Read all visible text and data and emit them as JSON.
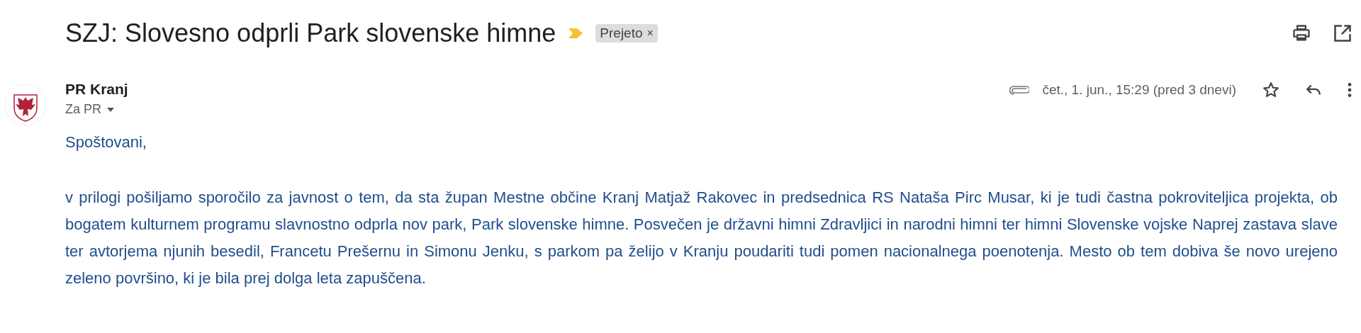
{
  "subject": "SZJ: Slovesno odprli Park slovenske himne",
  "label": {
    "text": "Prejeto",
    "remove": "×"
  },
  "sender": {
    "name": "PR Kranj",
    "recipient": "Za PR"
  },
  "date": "čet., 1. jun., 15:29 (pred 3 dnevi)",
  "starred": false,
  "body": [
    "Spoštovani,",
    "v prilogi pošiljamo sporočilo za javnost o tem, da sta župan Mestne občine Kranj Matjaž Rakovec in predsednica RS Nataša Pirc Musar, ki je tudi častna pokroviteljica projekta, ob bogatem kulturnem programu slavnostno odprla nov park, Park slovenske himne. Posvečen je državni himni Zdravljici in narodni himni ter himni Slovenske vojske Naprej zastava slave ter avtorjema njunih besedil, Francetu Prešernu in Simonu Jenku, s parkom pa želijo v Kranju poudariti tudi pomen nacionalnega poenotenja. Mesto ob tem dobiva še novo urejeno zeleno površino, ki je bila prej dolga leta zapuščena."
  ]
}
